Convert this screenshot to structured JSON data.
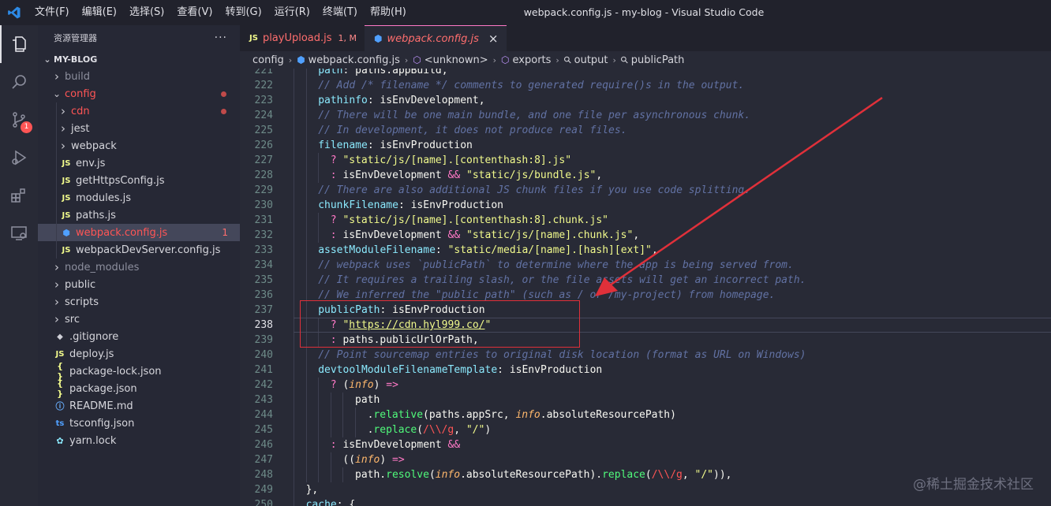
{
  "window": {
    "title": "webpack.config.js - my-blog - Visual Studio Code"
  },
  "menu": [
    "文件(F)",
    "编辑(E)",
    "选择(S)",
    "查看(V)",
    "转到(G)",
    "运行(R)",
    "终端(T)",
    "帮助(H)"
  ],
  "activity": {
    "scm_badge": "1"
  },
  "sidebar": {
    "title": "资源管理器",
    "more": "···",
    "root": "MY-BLOG",
    "items": [
      {
        "label": "build",
        "kind": "folder",
        "depth": 0,
        "style": "dim",
        "open": false
      },
      {
        "label": "config",
        "kind": "folder",
        "depth": 0,
        "style": "red",
        "open": true,
        "dot": true
      },
      {
        "label": "cdn",
        "kind": "folder",
        "depth": 1,
        "style": "red",
        "open": false,
        "dot": true
      },
      {
        "label": "jest",
        "kind": "folder",
        "depth": 1,
        "style": "norm",
        "open": false
      },
      {
        "label": "webpack",
        "kind": "folder",
        "depth": 1,
        "style": "norm",
        "open": false
      },
      {
        "label": "env.js",
        "kind": "js",
        "depth": 1,
        "style": "norm"
      },
      {
        "label": "getHttpsConfig.js",
        "kind": "js",
        "depth": 1,
        "style": "norm"
      },
      {
        "label": "modules.js",
        "kind": "js",
        "depth": 1,
        "style": "norm"
      },
      {
        "label": "paths.js",
        "kind": "js",
        "depth": 1,
        "style": "norm"
      },
      {
        "label": "webpack.config.js",
        "kind": "gear",
        "depth": 1,
        "style": "red",
        "selected": true,
        "count": "1"
      },
      {
        "label": "webpackDevServer.config.js",
        "kind": "js",
        "depth": 1,
        "style": "norm"
      },
      {
        "label": "node_modules",
        "kind": "folder",
        "depth": 0,
        "style": "dim",
        "open": false
      },
      {
        "label": "public",
        "kind": "folder",
        "depth": 0,
        "style": "norm",
        "open": false
      },
      {
        "label": "scripts",
        "kind": "folder",
        "depth": 0,
        "style": "norm",
        "open": false
      },
      {
        "label": "src",
        "kind": "folder",
        "depth": 0,
        "style": "norm",
        "open": false
      },
      {
        "label": ".gitignore",
        "kind": "git",
        "depth": 0,
        "style": "norm"
      },
      {
        "label": "deploy.js",
        "kind": "js",
        "depth": 0,
        "style": "norm"
      },
      {
        "label": "package-lock.json",
        "kind": "json",
        "depth": 0,
        "style": "norm"
      },
      {
        "label": "package.json",
        "kind": "json",
        "depth": 0,
        "style": "norm"
      },
      {
        "label": "README.md",
        "kind": "info",
        "depth": 0,
        "style": "norm"
      },
      {
        "label": "tsconfig.json",
        "kind": "ts",
        "depth": 0,
        "style": "norm"
      },
      {
        "label": "yarn.lock",
        "kind": "yarn",
        "depth": 0,
        "style": "norm"
      }
    ]
  },
  "tabs": [
    {
      "label": "playUpload.js",
      "icon": "JS",
      "status": "1, M",
      "active": false
    },
    {
      "label": "webpack.config.js",
      "icon": "gear",
      "active": true,
      "close": "×"
    }
  ],
  "breadcrumb": [
    "config",
    "webpack.config.js",
    "<unknown>",
    "exports",
    "output",
    "publicPath"
  ],
  "editor": {
    "current_line": 238,
    "lines": [
      {
        "n": 221,
        "indent": 2,
        "tokens": [
          [
            "p",
            "path"
          ],
          [
            "w",
            ": "
          ],
          [
            "w",
            "paths"
          ],
          [
            "w",
            "."
          ],
          [
            "w",
            "appBuild"
          ],
          [
            "w",
            ","
          ]
        ]
      },
      {
        "n": 222,
        "indent": 2,
        "tokens": [
          [
            "c",
            "// Add /* filename */ comments to generated require()s in the output."
          ]
        ]
      },
      {
        "n": 223,
        "indent": 2,
        "tokens": [
          [
            "p",
            "pathinfo"
          ],
          [
            "w",
            ": "
          ],
          [
            "w",
            "isEnvDevelopment"
          ],
          [
            "w",
            ","
          ]
        ]
      },
      {
        "n": 224,
        "indent": 2,
        "tokens": [
          [
            "c",
            "// There will be one main bundle, and one file per asynchronous chunk."
          ]
        ]
      },
      {
        "n": 225,
        "indent": 2,
        "tokens": [
          [
            "c",
            "// In development, it does not produce real files."
          ]
        ]
      },
      {
        "n": 226,
        "indent": 2,
        "tokens": [
          [
            "p",
            "filename"
          ],
          [
            "w",
            ": "
          ],
          [
            "w",
            "isEnvProduction"
          ]
        ]
      },
      {
        "n": 227,
        "indent": 3,
        "tokens": [
          [
            "o",
            "? "
          ],
          [
            "s",
            "\"static/js/[name].[contenthash:8].js\""
          ]
        ]
      },
      {
        "n": 228,
        "indent": 3,
        "tokens": [
          [
            "o",
            ": "
          ],
          [
            "w",
            "isEnvDevelopment "
          ],
          [
            "o",
            "&&"
          ],
          [
            "w",
            " "
          ],
          [
            "s",
            "\"static/js/bundle.js\""
          ],
          [
            "w",
            ","
          ]
        ]
      },
      {
        "n": 229,
        "indent": 2,
        "tokens": [
          [
            "c",
            "// There are also additional JS chunk files if you use code splitting."
          ]
        ]
      },
      {
        "n": 230,
        "indent": 2,
        "tokens": [
          [
            "p",
            "chunkFilename"
          ],
          [
            "w",
            ": "
          ],
          [
            "w",
            "isEnvProduction"
          ]
        ]
      },
      {
        "n": 231,
        "indent": 3,
        "tokens": [
          [
            "o",
            "? "
          ],
          [
            "s",
            "\"static/js/[name].[contenthash:8].chunk.js\""
          ]
        ]
      },
      {
        "n": 232,
        "indent": 3,
        "tokens": [
          [
            "o",
            ": "
          ],
          [
            "w",
            "isEnvDevelopment "
          ],
          [
            "o",
            "&&"
          ],
          [
            "w",
            " "
          ],
          [
            "s",
            "\"static/js/[name].chunk.js\""
          ],
          [
            "w",
            ","
          ]
        ]
      },
      {
        "n": 233,
        "indent": 2,
        "tokens": [
          [
            "p",
            "assetModuleFilename"
          ],
          [
            "w",
            ": "
          ],
          [
            "s",
            "\"static/media/[name].[hash][ext]\""
          ],
          [
            "w",
            ","
          ]
        ]
      },
      {
        "n": 234,
        "indent": 2,
        "tokens": [
          [
            "c",
            "// webpack uses `publicPath` to determine where the app is being served from."
          ]
        ]
      },
      {
        "n": 235,
        "indent": 2,
        "tokens": [
          [
            "c",
            "// It requires a trailing slash, or the file assets will get an incorrect path."
          ]
        ]
      },
      {
        "n": 236,
        "indent": 2,
        "tokens": [
          [
            "c",
            "// We inferred the \"public path\" (such as / or /my-project) from homepage."
          ]
        ]
      },
      {
        "n": 237,
        "indent": 2,
        "tokens": [
          [
            "p",
            "publicPath"
          ],
          [
            "w",
            ": "
          ],
          [
            "w",
            "isEnvProduction"
          ]
        ]
      },
      {
        "n": 238,
        "indent": 3,
        "tokens": [
          [
            "o",
            "? "
          ],
          [
            "s",
            "\""
          ],
          [
            "u",
            "https://cdn.hyl999.co/"
          ],
          [
            "s",
            "\""
          ]
        ]
      },
      {
        "n": 239,
        "indent": 3,
        "tokens": [
          [
            "o",
            ": "
          ],
          [
            "w",
            "paths"
          ],
          [
            "w",
            "."
          ],
          [
            "w",
            "publicUrlOrPath"
          ],
          [
            "w",
            ","
          ]
        ]
      },
      {
        "n": 240,
        "indent": 2,
        "tokens": [
          [
            "c",
            "// Point sourcemap entries to original disk location (format as URL on Windows)"
          ]
        ]
      },
      {
        "n": 241,
        "indent": 2,
        "tokens": [
          [
            "p",
            "devtoolModuleFilenameTemplate"
          ],
          [
            "w",
            ": "
          ],
          [
            "w",
            "isEnvProduction"
          ]
        ]
      },
      {
        "n": 242,
        "indent": 3,
        "tokens": [
          [
            "o",
            "? "
          ],
          [
            "w",
            "("
          ],
          [
            "i",
            "info"
          ],
          [
            "w",
            ") "
          ],
          [
            "k",
            "=>"
          ]
        ]
      },
      {
        "n": 243,
        "indent": 5,
        "tokens": [
          [
            "w",
            "path"
          ]
        ]
      },
      {
        "n": 244,
        "indent": 6,
        "tokens": [
          [
            "w",
            "."
          ],
          [
            "f",
            "relative"
          ],
          [
            "w",
            "(paths.appSrc, "
          ],
          [
            "i",
            "info"
          ],
          [
            "w",
            ".absoluteResourcePath)"
          ]
        ]
      },
      {
        "n": 245,
        "indent": 6,
        "tokens": [
          [
            "w",
            "."
          ],
          [
            "f",
            "replace"
          ],
          [
            "w",
            "("
          ],
          [
            "r",
            "/\\\\/g"
          ],
          [
            "w",
            ", "
          ],
          [
            "s",
            "\"/\""
          ],
          [
            "w",
            ")"
          ]
        ]
      },
      {
        "n": 246,
        "indent": 3,
        "tokens": [
          [
            "o",
            ": "
          ],
          [
            "w",
            "isEnvDevelopment "
          ],
          [
            "o",
            "&&"
          ]
        ]
      },
      {
        "n": 247,
        "indent": 4,
        "tokens": [
          [
            "w",
            "(("
          ],
          [
            "i",
            "info"
          ],
          [
            "w",
            ") "
          ],
          [
            "k",
            "=>"
          ]
        ]
      },
      {
        "n": 248,
        "indent": 5,
        "tokens": [
          [
            "w",
            "path."
          ],
          [
            "f",
            "resolve"
          ],
          [
            "w",
            "("
          ],
          [
            "i",
            "info"
          ],
          [
            "w",
            ".absoluteResourcePath)."
          ],
          [
            "f",
            "replace"
          ],
          [
            "w",
            "("
          ],
          [
            "r",
            "/\\\\/g"
          ],
          [
            "w",
            ", "
          ],
          [
            "s",
            "\"/\""
          ],
          [
            "w",
            ")),"
          ]
        ]
      },
      {
        "n": 249,
        "indent": 1,
        "tokens": [
          [
            "w",
            "},"
          ]
        ]
      },
      {
        "n": 250,
        "indent": 1,
        "tokens": [
          [
            "p",
            "cache"
          ],
          [
            "w",
            ": {"
          ]
        ]
      }
    ]
  },
  "watermark": "@稀土掘金技术社区",
  "colors": {
    "accent": "#ff79c6",
    "annotation": "#e0303a",
    "background": "#282a36"
  }
}
